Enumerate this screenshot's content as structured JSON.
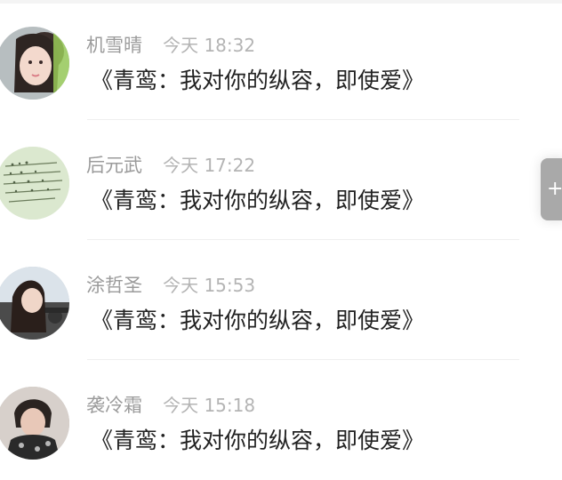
{
  "comments": [
    {
      "author": "机雪晴",
      "time": "今天 18:32",
      "title": "《青鸾：我对你的纵容，即使爱》",
      "avatar_icon": "user-photo-icon"
    },
    {
      "author": "后元武",
      "time": "今天 17:22",
      "title": "《青鸾：我对你的纵容，即使爱》",
      "avatar_icon": "handwriting-photo-icon"
    },
    {
      "author": "涂哲圣",
      "time": "今天 15:53",
      "title": "《青鸾：我对你的纵容，即使爱》",
      "avatar_icon": "car-photo-icon"
    },
    {
      "author": "袭冷霜",
      "time": "今天 15:18",
      "title": "《青鸾：我对你的纵容，即使爱》",
      "avatar_icon": "portrait-photo-icon"
    }
  ],
  "floating_button": {
    "icon": "add-icon"
  },
  "colors": {
    "author": "#9b9b9b",
    "time": "#b4b4b4",
    "title": "#222222",
    "divider": "#efefef",
    "floating_button": "#a9a9a9"
  }
}
